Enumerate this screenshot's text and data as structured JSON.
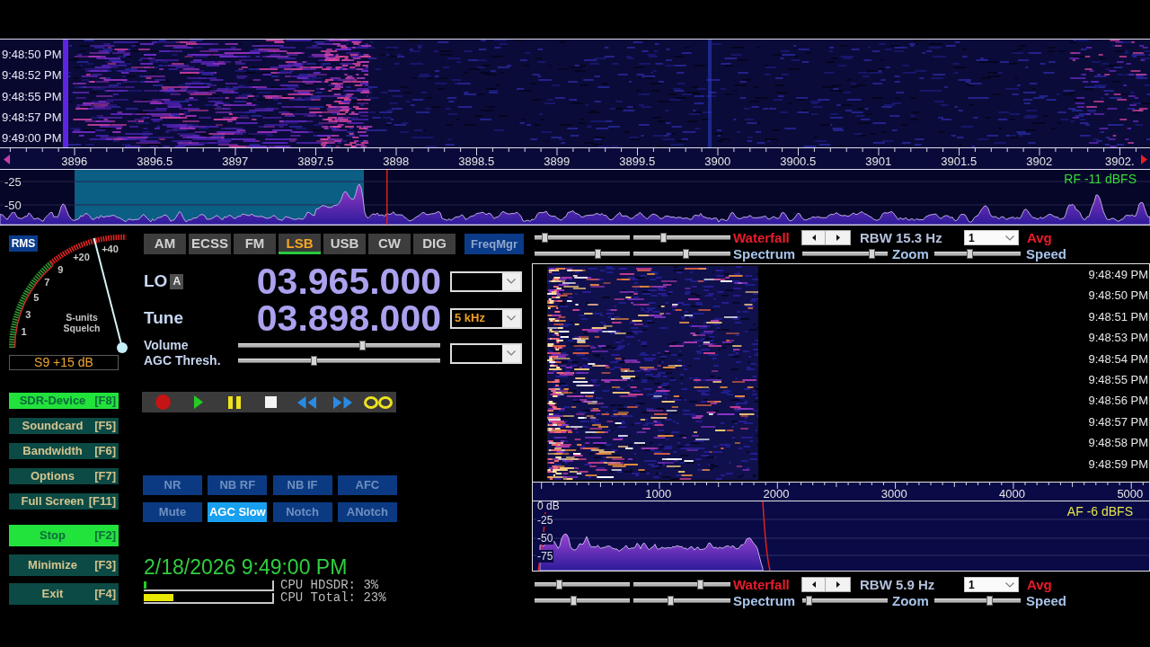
{
  "rf_waterfall": {
    "timestamps": [
      "9:48:50 PM",
      "9:48:52 PM",
      "9:48:55 PM",
      "9:48:57 PM",
      "9:49:00 PM"
    ]
  },
  "rf_axis": {
    "labels": [
      "3896",
      "3896.5",
      "3897",
      "3897.5",
      "3898",
      "3898.5",
      "3899",
      "3899.5",
      "3900",
      "3900.5",
      "3901",
      "3901.5",
      "3902",
      "3902."
    ]
  },
  "rf_spectrum": {
    "scale": [
      "-25",
      "-50"
    ],
    "reading": "RF -11 dBFS"
  },
  "s_meter": {
    "badge": "RMS",
    "scale": [
      "1",
      "3",
      "5",
      "7",
      "9",
      "+20",
      "+40"
    ],
    "captions": [
      "S-units",
      "Squelch"
    ],
    "level": 0.84,
    "reading": "S9 +15 dB"
  },
  "setup_buttons": [
    {
      "label": "SDR-Device",
      "shortcut": "[F8]",
      "active": true
    },
    {
      "label": "Soundcard",
      "shortcut": "[F5]",
      "active": false
    },
    {
      "label": "Bandwidth",
      "shortcut": "[F6]",
      "active": false
    },
    {
      "label": "Options",
      "shortcut": "[F7]",
      "active": false
    },
    {
      "label": "Full Screen",
      "shortcut": "[F11]",
      "active": false
    }
  ],
  "control_buttons": [
    {
      "label": "Stop",
      "shortcut": "[F2]",
      "active": true
    },
    {
      "label": "Minimize",
      "shortcut": "[F3]",
      "active": false
    },
    {
      "label": "Exit",
      "shortcut": "[F4]",
      "active": false
    }
  ],
  "modes": [
    {
      "label": "AM",
      "selected": false
    },
    {
      "label": "ECSS",
      "selected": false
    },
    {
      "label": "FM",
      "selected": false
    },
    {
      "label": "LSB",
      "selected": true
    },
    {
      "label": "USB",
      "selected": false
    },
    {
      "label": "CW",
      "selected": false
    },
    {
      "label": "DIG",
      "selected": false
    }
  ],
  "freq_manager": {
    "label": "FreqMgr"
  },
  "lo": {
    "label": "LO",
    "vfo": "A",
    "frequency": "03.965.000"
  },
  "tune": {
    "label": "Tune",
    "frequency": "03.898.000",
    "step": "5 kHz"
  },
  "sliders": [
    {
      "label": "Volume",
      "level": 0.62
    },
    {
      "label": "AGC Thresh.",
      "level": 0.37
    }
  ],
  "transport": [
    {
      "kind": "record"
    },
    {
      "kind": "play"
    },
    {
      "kind": "pause"
    },
    {
      "kind": "stop"
    },
    {
      "kind": "rewind"
    },
    {
      "kind": "forward"
    },
    {
      "kind": "loop"
    }
  ],
  "dsp_buttons": [
    {
      "label": "NR",
      "selected": false
    },
    {
      "label": "NB RF",
      "selected": false
    },
    {
      "label": "NB IF",
      "selected": false
    },
    {
      "label": "AFC",
      "selected": false
    },
    {
      "label": "Mute",
      "selected": false
    },
    {
      "label": "AGC Slow",
      "selected": true
    },
    {
      "label": "Notch",
      "selected": false
    },
    {
      "label": "ANotch",
      "selected": false
    }
  ],
  "clock": "2/18/2026 9:49:00 PM",
  "cpu": [
    {
      "label": "CPU HDSDR: 3%",
      "level": 0.02,
      "color": "#22cc22"
    },
    {
      "label": "CPU Total: 23%",
      "level": 0.23,
      "color": "#e8e800"
    }
  ],
  "upper_controls": {
    "waterfall_sliders": [
      {
        "level": 0.08
      },
      {
        "level": 0.3
      }
    ],
    "waterfall_label": "Waterfall",
    "rbw": "RBW 15.3 Hz",
    "average": "1",
    "average_label": "Avg",
    "spectrum_sliders": [
      {
        "level": 0.68
      },
      {
        "level": 0.54
      }
    ],
    "spectrum_label": "Spectrum",
    "zoom_slider": {
      "level": 0.84
    },
    "zoom_label": "Zoom",
    "speed_slider": {
      "level": 0.4
    },
    "speed_label": "Speed"
  },
  "af_waterfall": {
    "timestamps": [
      "9:48:49 PM",
      "9:48:50 PM",
      "9:48:51 PM",
      "9:48:53 PM",
      "9:48:54 PM",
      "9:48:55 PM",
      "9:48:56 PM",
      "9:48:57 PM",
      "9:48:58 PM",
      "9:48:59 PM"
    ]
  },
  "af_axis": {
    "labels": [
      "1000",
      "2000",
      "3000",
      "4000",
      "5000"
    ]
  },
  "af_spectrum": {
    "scale": [
      "0 dB",
      "-25",
      "-50",
      "-75"
    ],
    "reading": "AF -6 dBFS"
  },
  "lower_controls": {
    "waterfall_sliders": [
      {
        "level": 0.24
      },
      {
        "level": 0.7
      }
    ],
    "waterfall_label": "Waterfall",
    "rbw": "RBW 5.9 Hz",
    "average": "1",
    "average_label": "Avg",
    "spectrum_sliders": [
      {
        "level": 0.4
      },
      {
        "level": 0.38
      }
    ],
    "spectrum_label": "Spectrum",
    "zoom_slider": {
      "level": 0.05
    },
    "zoom_label": "Zoom",
    "speed_slider": {
      "level": 0.65
    },
    "speed_label": "Speed"
  }
}
